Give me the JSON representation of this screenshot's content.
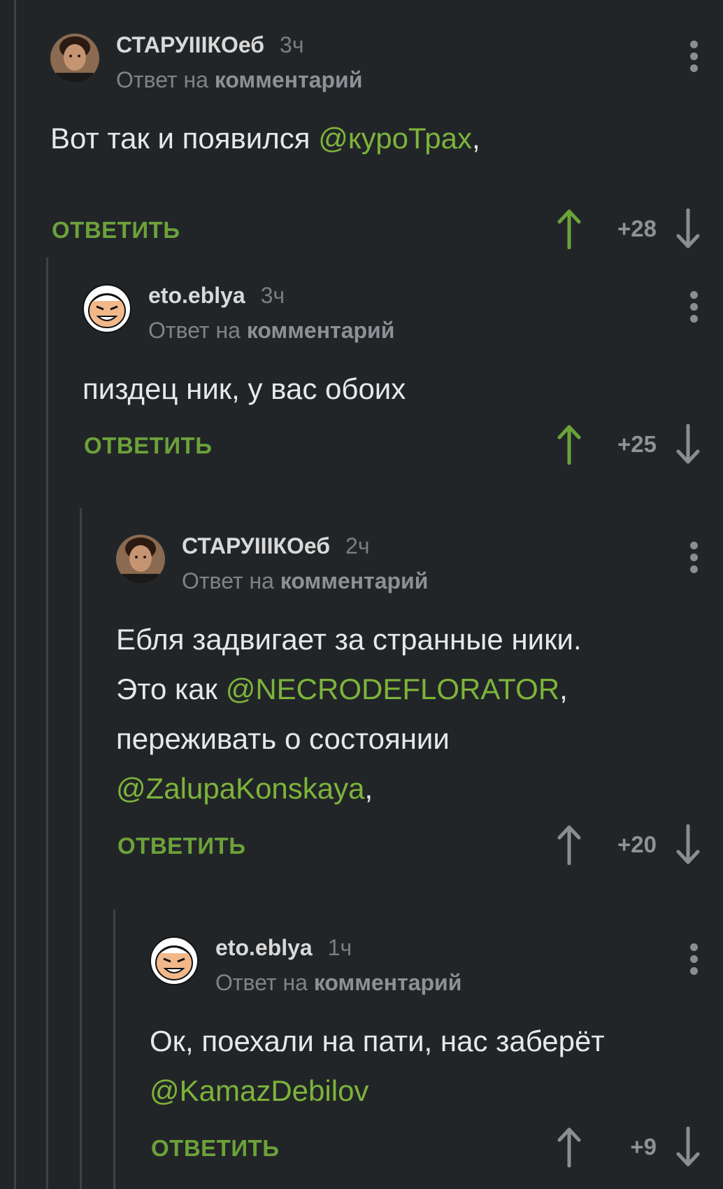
{
  "colors": {
    "background": "#222528",
    "mention": "#7db43a",
    "reply_button": "#6ca23a",
    "upvote_active": "#6ca23a",
    "icon_gray": "#8a8e92"
  },
  "comments": [
    {
      "author": "СТАРУIIIКОеб",
      "time": "3ч",
      "reply_prefix": "Ответ на",
      "reply_target": "комментарий",
      "lines": [
        [
          {
            "t": "Вот так и появился "
          },
          {
            "t": "@куроТрах",
            "mention": true
          },
          {
            "t": ","
          }
        ]
      ],
      "reply_label": "ОТВЕТИТЬ",
      "score": "+28",
      "upvoted": true,
      "avatar_icon": "user-photo-avatar",
      "menu_icon": "more-vertical-icon"
    },
    {
      "author": "eto.eblya",
      "time": "3ч",
      "reply_prefix": "Ответ на",
      "reply_target": "комментарий",
      "lines": [
        [
          {
            "t": "пиздец ник, у вас обоих"
          }
        ]
      ],
      "reply_label": "ОТВЕТИТЬ",
      "score": "+25",
      "upvoted": true,
      "avatar_icon": "cartoon-face-avatar",
      "menu_icon": "more-vertical-icon"
    },
    {
      "author": "СТАРУIIIКОеб",
      "time": "2ч",
      "reply_prefix": "Ответ на",
      "reply_target": "комментарий",
      "lines": [
        [
          {
            "t": "Ебля задвигает за странные ники."
          }
        ],
        [
          {
            "t": "Это как "
          },
          {
            "t": "@NECRODEFLORATOR",
            "mention": true
          },
          {
            "t": ","
          }
        ],
        [
          {
            "t": "переживать о состоянии"
          }
        ],
        [
          {
            "t": "@ZalupaKonskaya",
            "mention": true
          },
          {
            "t": ","
          }
        ]
      ],
      "reply_label": "ОТВЕТИТЬ",
      "score": "+20",
      "upvoted": false,
      "avatar_icon": "user-photo-avatar",
      "menu_icon": "more-vertical-icon"
    },
    {
      "author": "eto.eblya",
      "time": "1ч",
      "reply_prefix": "Ответ на",
      "reply_target": "комментарий",
      "lines": [
        [
          {
            "t": "Ок, поехали на пати, нас заберёт"
          }
        ],
        [
          {
            "t": "@KamazDebilov",
            "mention": true
          }
        ]
      ],
      "reply_label": "ОТВЕТИТЬ",
      "score": "+9",
      "upvoted": false,
      "avatar_icon": "cartoon-face-avatar",
      "menu_icon": "more-vertical-icon"
    }
  ]
}
